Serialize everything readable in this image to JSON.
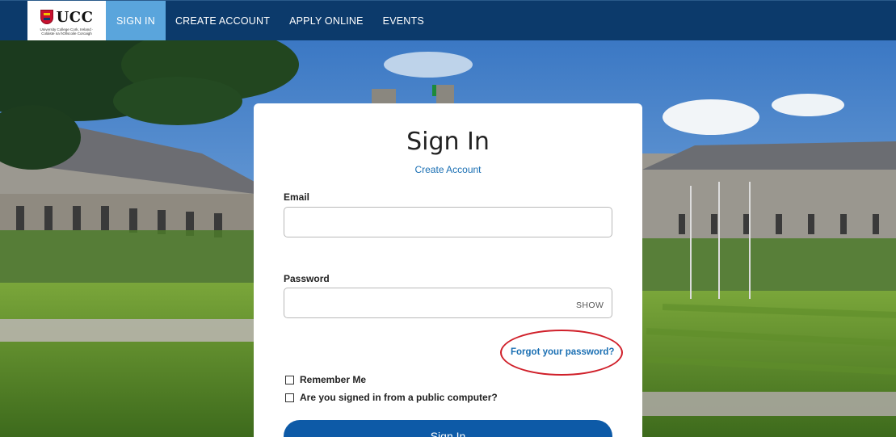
{
  "nav": {
    "logo": {
      "name": "UCC",
      "subtitle": "University College Cork, Ireland · Coláiste na hOllscoile Corcaigh"
    },
    "items": [
      {
        "label": "SIGN IN",
        "active": true
      },
      {
        "label": "CREATE ACCOUNT",
        "active": false
      },
      {
        "label": "APPLY ONLINE",
        "active": false
      },
      {
        "label": "EVENTS",
        "active": false
      }
    ],
    "colors": {
      "bar": "#0c3a6b",
      "active": "#5aa5dc"
    }
  },
  "form": {
    "title": "Sign In",
    "create_account_link": "Create Account",
    "email": {
      "label": "Email",
      "value": "",
      "placeholder": ""
    },
    "password": {
      "label": "Password",
      "value": "",
      "placeholder": "",
      "toggle": "SHOW"
    },
    "forgot_link": "Forgot your password?",
    "remember_me": {
      "label": "Remember Me",
      "checked": false
    },
    "public_computer": {
      "label": "Are you signed in from a public computer?",
      "checked": false
    },
    "submit_label": "Sign In"
  },
  "icons": [
    "ucc-crest-icon",
    "checkbox-icon"
  ],
  "accent": "#1a6fb3"
}
